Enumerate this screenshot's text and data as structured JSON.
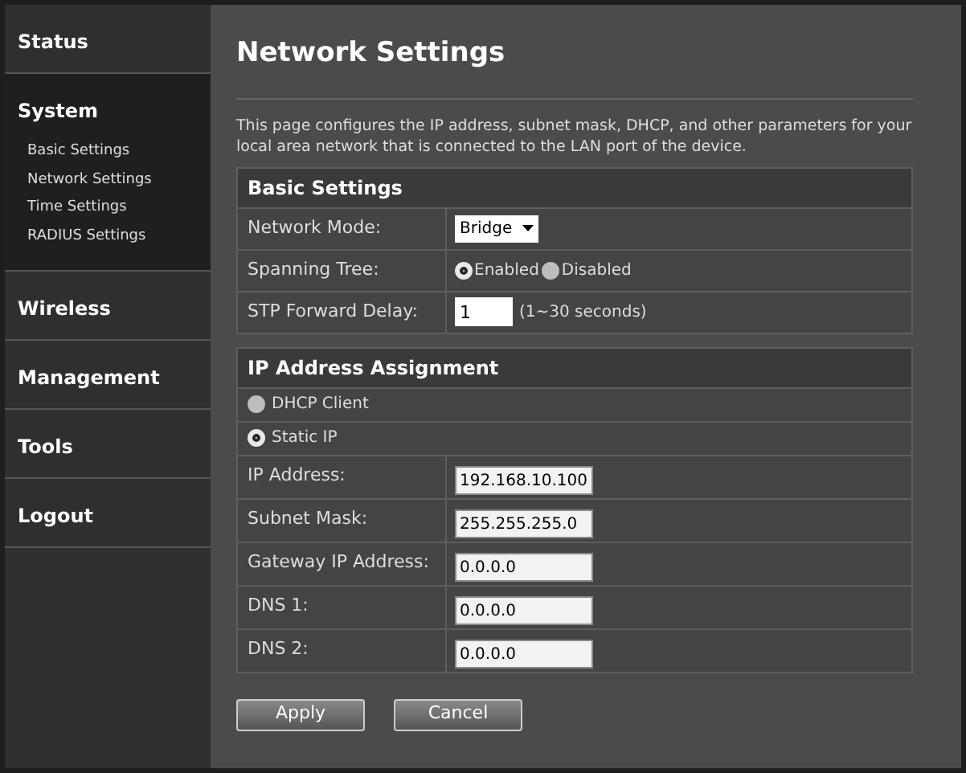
{
  "sidebar": {
    "items": [
      {
        "label": "Status",
        "selected": false
      },
      {
        "label": "System",
        "selected": true,
        "children": [
          {
            "label": "Basic Settings"
          },
          {
            "label": "Network Settings"
          },
          {
            "label": "Time Settings"
          },
          {
            "label": "RADIUS Settings"
          }
        ]
      },
      {
        "label": "Wireless",
        "selected": false
      },
      {
        "label": "Management",
        "selected": false
      },
      {
        "label": "Tools",
        "selected": false
      },
      {
        "label": "Logout",
        "selected": false
      }
    ]
  },
  "page": {
    "title": "Network Settings",
    "description": "This page configures the IP address, subnet mask, DHCP, and other parameters for your local area network that is connected to the LAN port of the device."
  },
  "basic_settings": {
    "title": "Basic Settings",
    "network_mode": {
      "label": "Network Mode:",
      "value": "Bridge"
    },
    "spanning_tree": {
      "label": "Spanning Tree:",
      "options": [
        {
          "label": "Enabled",
          "selected": true
        },
        {
          "label": "Disabled",
          "selected": false
        }
      ]
    },
    "stp_forward_delay": {
      "label": "STP Forward Delay:",
      "value": "1",
      "hint": "(1~30 seconds)"
    }
  },
  "ip_assignment": {
    "title": "IP Address Assignment",
    "options": [
      {
        "label": "DHCP Client",
        "selected": false
      },
      {
        "label": "Static IP",
        "selected": true
      }
    ],
    "fields": [
      {
        "label": "IP Address:",
        "value": "192.168.10.100"
      },
      {
        "label": "Subnet Mask:",
        "value": "255.255.255.0"
      },
      {
        "label": "Gateway IP Address:",
        "value": "0.0.0.0"
      },
      {
        "label": "DNS 1:",
        "value": "0.0.0.0"
      },
      {
        "label": "DNS 2:",
        "value": "0.0.0.0"
      }
    ]
  },
  "buttons": [
    "Apply",
    "Cancel"
  ]
}
